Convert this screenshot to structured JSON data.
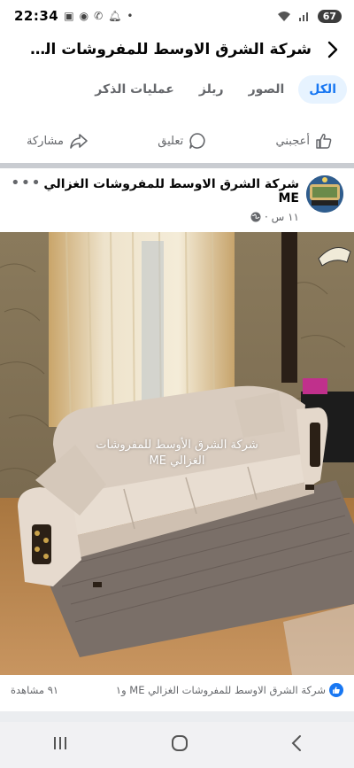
{
  "status_bar": {
    "time": "22:34",
    "battery": "67"
  },
  "header": {
    "title": "شركة الشرق الاوسط للمفروشات الغ..."
  },
  "tabs": [
    {
      "label": "الكل"
    },
    {
      "label": "الصور"
    },
    {
      "label": "ريلز"
    },
    {
      "label": "عمليات الذكر"
    }
  ],
  "actions": {
    "like": "أعجبني",
    "comment": "تعليق",
    "share": "مشاركة"
  },
  "post": {
    "page_name": "شركة الشرق الاوسط للمفروشات الغزالي ME",
    "time": "١١ س ·",
    "watermark_line1": "شركة الشرق الأوسط للمفروشات",
    "watermark_line2": "الغزالي ME"
  },
  "reactions": {
    "text": "شركة الشرق الاوسط للمفروشات الغزالي ME و١",
    "views": "٩١ مشاهدة"
  },
  "colors": {
    "accent": "#1877f2",
    "tab_bg": "#e7f3ff",
    "muted": "#65676b"
  }
}
